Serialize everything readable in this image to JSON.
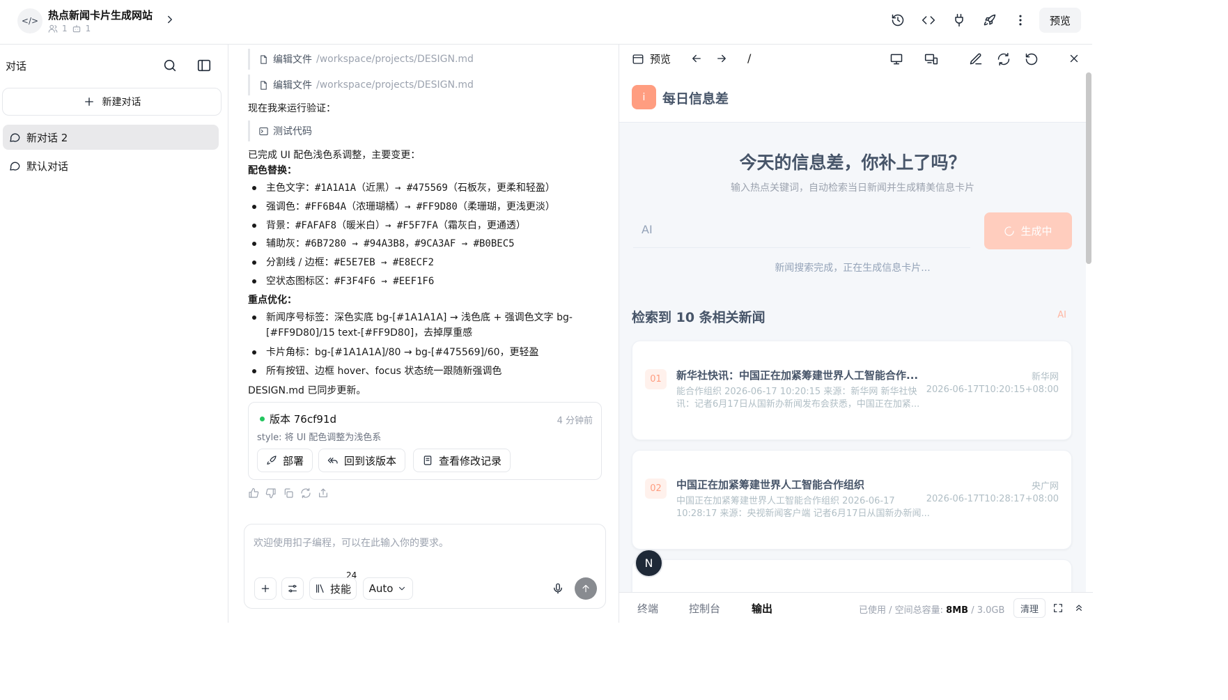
{
  "header": {
    "project_icon": "</>",
    "project_title": "热点新闻卡片生成网站",
    "members_count": "1",
    "bots_count": "1",
    "preview_label": "预览",
    "icons": [
      "history-icon",
      "code-icon",
      "plug-icon",
      "rocket-icon",
      "more-vertical-icon"
    ]
  },
  "sidebar": {
    "title": "对话",
    "new_chat_label": "新建对话",
    "conversations": [
      {
        "label": "新对话 2",
        "active": true
      },
      {
        "label": "默认对话",
        "active": false
      }
    ]
  },
  "chat": {
    "tool_calls": [
      {
        "label": "编辑文件",
        "path": "/workspace/projects/DESIGN.md"
      },
      {
        "label": "编辑文件",
        "path": "/workspace/projects/DESIGN.md"
      }
    ],
    "run_verify_text": "现在我来运行验证：",
    "test_label": "测试代码",
    "summary_intro": "已完成 UI 配色浅色系调整，主要变更：",
    "color_heading": "配色替换：",
    "color_items": [
      {
        "label": "主色文字：",
        "code": "#1A1A1A（近黑）→ #475569（石板灰，更柔和轻盈）"
      },
      {
        "label": "强调色：",
        "code": "#FF6B4A（浓珊瑚橘）→ #FF9D80（柔珊瑚，更浅更淡）"
      },
      {
        "label": "背景：",
        "code": "#FAFAF8（暖米白）→ #F5F7FA（霜灰白，更通透）"
      },
      {
        "label": "辅助灰：",
        "code": "#6B7280 → #94A3B8，#9CA3AF → #B0BEC5"
      },
      {
        "label": "分割线 / 边框：",
        "code": "#E5E7EB → #E8ECF2"
      },
      {
        "label": "空状态图标区：",
        "code": "#F3F4F6 → #EEF1F6"
      }
    ],
    "optimize_heading": "重点优化：",
    "optimize_items": [
      "新闻序号标签：深色实底 bg-[#1A1A1A] → 浅色底 + 强调色文字 bg-[#FF9D80]/15 text-[#FF9D80]，去掉厚重感",
      "卡片角标：bg-[#1A1A1A]/80 → bg-[#475569]/60，更轻盈",
      "所有按钮、边框 hover、focus 状态统一跟随新强调色"
    ],
    "design_synced": "DESIGN.md 已同步更新。",
    "version": {
      "name": "版本 76cf91d",
      "time": "4 分钟前",
      "desc": "style: 将 UI 配色调整为浅色系",
      "deploy_label": "部署",
      "rollback_label": "回到该版本",
      "history_label": "查看修改记录"
    },
    "composer": {
      "placeholder": "欢迎使用扣子编程，可以在此输入你的要求。",
      "skills_label": "技能",
      "skills_count": "24",
      "mode_label": "Auto"
    }
  },
  "preview": {
    "label": "预览",
    "path": "/",
    "site": {
      "logo_letter": "i",
      "name": "每日信息差",
      "hero_title": "今天的信息差，你补上了吗？",
      "hero_sub": "输入热点关键词，自动检索当日新闻并生成精美信息卡片",
      "input_value": "AI",
      "generate_label": "生成中",
      "status": "新闻搜索完成，正在生成信息卡片...",
      "results_title": "检索到 10 条相关新闻",
      "results_tag": "AI",
      "news": [
        {
          "num": "01",
          "title": "新华社快讯：中国正在加紧筹建世界人工智能合作...",
          "summary": "能合作组织 2026-06-17 10:20:15 来源：新华网 新华社快讯：记者6月17日从国新办新闻发布会获悉，中国正在加紧...",
          "source": "新华网",
          "date": "2026-06-17T10:20:15+08:00"
        },
        {
          "num": "02",
          "title": "中国正在加紧筹建世界人工智能合作组织",
          "summary": "中国正在加紧筹建世界人工智能合作组织 2026-06-17 10:28:17 来源：央视新闻客户端 记者6月17日从国新办新闻...",
          "source": "央广网",
          "date": "2026-06-17T10:28:17+08:00"
        }
      ],
      "colors": {
        "accent": "#FF9D80",
        "text": "#475569",
        "bg": "#F5F7FA",
        "muted": "#94A3B8"
      }
    },
    "floating_badge": "N",
    "bottom": {
      "tabs": [
        "终端",
        "控制台",
        "输出"
      ],
      "active_tab": "输出",
      "usage_label": "已使用 / 空间总容量:",
      "usage_used": "8MB",
      "usage_total": "3.0GB",
      "clear_label": "清理"
    }
  }
}
